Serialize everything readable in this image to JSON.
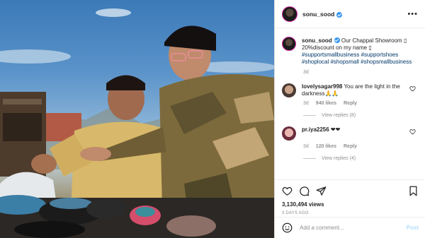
{
  "post": {
    "username": "sonu_sood",
    "more_label": "•••"
  },
  "caption": {
    "username": "sonu_sood",
    "text_1": " Our Chappal Showroom ",
    "text_2": " 20%discount on my name ",
    "hashtags": "#supportsmallbusiness #supportshoes #shoplocal #shopsmall #shopsmallbusiness",
    "age": "3d"
  },
  "comments": [
    {
      "username": "lovelysagar998",
      "text": " You are the light in the darkness🙏🙏",
      "age": "3d",
      "likes": "940 likes",
      "reply": "Reply",
      "view_replies": "View replies (8)"
    },
    {
      "username": "pr.iya2256",
      "text": " ❤❤",
      "age": "3d",
      "likes": "120 likes",
      "reply": "Reply",
      "view_replies": "View replies (4)"
    }
  ],
  "stats": {
    "views": "3,130,494 views",
    "posted": "3 DAYS AGO"
  },
  "add_comment": {
    "placeholder": "Add a comment...",
    "post_label": "Post"
  },
  "icons": {
    "like": "heart-icon",
    "comment": "comment-icon",
    "share": "share-icon",
    "save": "bookmark-icon",
    "emoji": "emoji-icon"
  },
  "colors": {
    "link": "#00376b",
    "muted": "#8e8e8e",
    "verified": "#3897f0",
    "post_disabled": "#b2dffc"
  }
}
